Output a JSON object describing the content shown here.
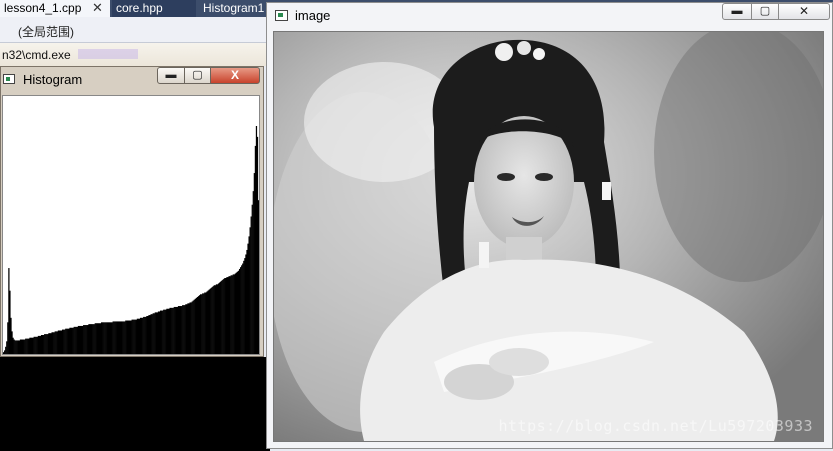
{
  "ide": {
    "tabs": [
      {
        "label": "lesson4_1.cpp",
        "close": "✕"
      },
      {
        "label": "core.hpp"
      },
      {
        "label": "Histogram1"
      }
    ],
    "scope": "(全局范围)"
  },
  "cmd": {
    "title": "n32\\cmd.exe"
  },
  "histogram_window": {
    "title": "Histogram",
    "min_glyph": "▬",
    "max_glyph": "▢",
    "close_glyph": "X"
  },
  "image_window": {
    "title": "image",
    "min_glyph": "▬",
    "max_glyph": "▢",
    "close_glyph": "✕",
    "watermark": "https://blog.csdn.net/Lu597203933"
  },
  "chart_data": {
    "type": "area",
    "bins": 256,
    "values": [
      2,
      4,
      8,
      14,
      35,
      95,
      70,
      40,
      25,
      18,
      16,
      15,
      15,
      15,
      15,
      15,
      16,
      16,
      16,
      16,
      16,
      17,
      17,
      17,
      17,
      18,
      18,
      18,
      18,
      19,
      19,
      19,
      19,
      20,
      20,
      20,
      21,
      21,
      21,
      22,
      22,
      22,
      22,
      23,
      23,
      23,
      24,
      24,
      24,
      25,
      25,
      25,
      26,
      26,
      26,
      26,
      27,
      27,
      27,
      28,
      28,
      28,
      28,
      29,
      29,
      29,
      29,
      30,
      30,
      30,
      30,
      31,
      31,
      31,
      31,
      31,
      32,
      32,
      32,
      32,
      32,
      33,
      33,
      33,
      33,
      33,
      33,
      34,
      34,
      34,
      34,
      34,
      34,
      35,
      35,
      35,
      35,
      35,
      35,
      35,
      35,
      35,
      35,
      35,
      36,
      36,
      36,
      36,
      36,
      36,
      36,
      36,
      36,
      36,
      36,
      36,
      37,
      37,
      37,
      37,
      37,
      37,
      38,
      38,
      38,
      38,
      38,
      39,
      39,
      39,
      40,
      40,
      40,
      41,
      41,
      41,
      42,
      42,
      43,
      43,
      44,
      44,
      45,
      45,
      46,
      46,
      46,
      47,
      47,
      48,
      48,
      48,
      49,
      49,
      49,
      50,
      50,
      50,
      51,
      51,
      51,
      51,
      52,
      52,
      52,
      52,
      53,
      53,
      53,
      53,
      54,
      54,
      54,
      55,
      55,
      56,
      56,
      57,
      57,
      58,
      59,
      60,
      61,
      62,
      63,
      64,
      65,
      66,
      66,
      67,
      67,
      68,
      68,
      69,
      70,
      71,
      72,
      73,
      74,
      75,
      76,
      76,
      77,
      77,
      78,
      79,
      80,
      81,
      82,
      83,
      84,
      84,
      85,
      85,
      86,
      86,
      87,
      87,
      88,
      88,
      89,
      90,
      91,
      92,
      94,
      96,
      98,
      100,
      103,
      106,
      110,
      115,
      122,
      130,
      140,
      152,
      165,
      180,
      200,
      230,
      252,
      240,
      170
    ]
  }
}
